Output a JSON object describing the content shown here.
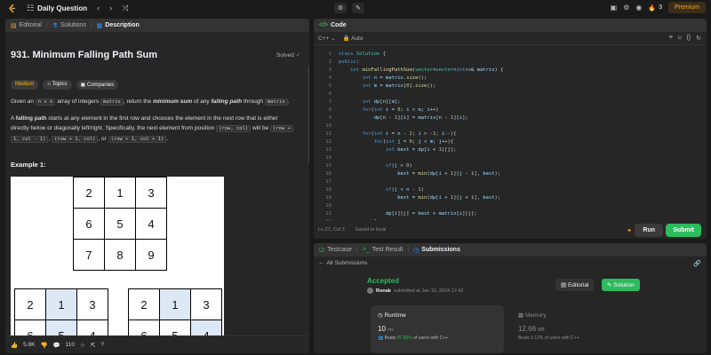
{
  "topbar": {
    "title": "Daily Question",
    "streak": "3",
    "premium": "Premium"
  },
  "left": {
    "tabs": [
      "Editorial",
      "Solutions",
      "Description"
    ],
    "title": "931. Minimum Falling Path Sum",
    "solved": "Solved",
    "tags": [
      "Medium",
      "Topics",
      "Companies"
    ],
    "p1": [
      "Given an ",
      "n x n",
      " array of integers ",
      "matrix",
      ", return the ",
      "minimum sum",
      " of any ",
      "falling path",
      " through ",
      "matrix",
      "."
    ],
    "p2a": [
      "A ",
      "falling path",
      " starts at any element in the first row and chooses the element in the next row that is either"
    ],
    "p2b": [
      "directly below or diagonally left/right. Specifically, the next element from position ",
      "(row, col)",
      " will be ",
      "(row +"
    ],
    "p2c": [
      "1, col - 1)",
      ", ",
      "(row + 1, col)",
      ", or ",
      "(row + 1, col + 1)",
      "."
    ],
    "example": "Example 1:",
    "grid_top": [
      [
        2,
        1,
        3
      ],
      [
        6,
        5,
        4
      ],
      [
        7,
        8,
        9
      ]
    ],
    "grid_bl": [
      [
        2,
        1,
        3
      ],
      [
        6,
        5,
        4
      ]
    ],
    "grid_br": [
      [
        2,
        1,
        3
      ],
      [
        6,
        5,
        4
      ]
    ],
    "footer": {
      "likes": "5.8K",
      "comments": "110"
    }
  },
  "code": {
    "tab": "Code",
    "lang": "C++",
    "auto": "Auto",
    "status_pos": "Ln 27, Col 3",
    "status_saved": "Saved to local",
    "run": "Run",
    "submit": "Submit"
  },
  "result": {
    "tabs": [
      "Testcase",
      "Test Result",
      "Submissions"
    ],
    "back": "All Submissions",
    "status": "Accepted",
    "user": "Ronak",
    "submitted": "submitted at Jan 19, 2024 17:42",
    "editorial": "Editorial",
    "solution": "Solution",
    "runtime_label": "Runtime",
    "runtime_value": "10",
    "runtime_unit": "ms",
    "runtime_beats_pre": "Beats",
    "runtime_beats": "87.60%",
    "runtime_beats_post": "of users with C++",
    "memory_label": "Memory",
    "memory_value": "12.66",
    "memory_unit": "MB",
    "memory_beats_pre": "Beats",
    "memory_beats": "5.13%",
    "memory_beats_post": "of users with C++"
  }
}
